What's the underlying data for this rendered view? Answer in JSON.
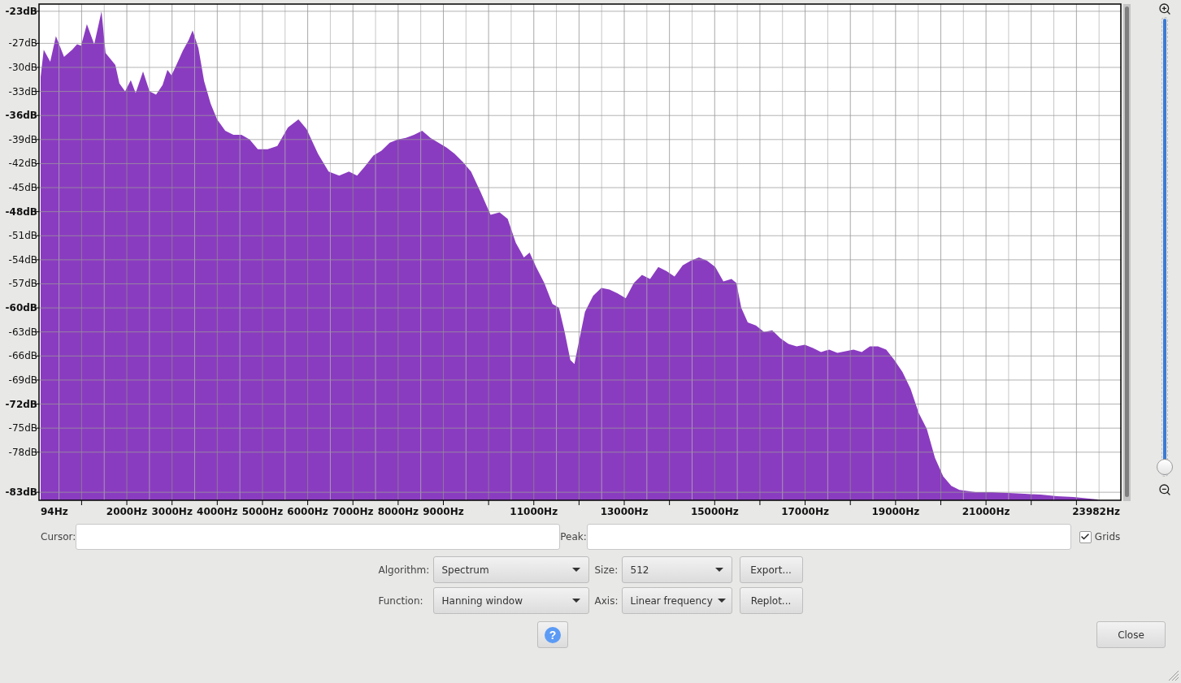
{
  "spectrum": {
    "chart_data": {
      "type": "area",
      "xlim": [
        94,
        23982
      ],
      "ylim": [
        -84,
        -22.1
      ],
      "x": [
        94,
        94,
        162,
        306,
        432,
        612,
        792,
        900,
        990,
        1116,
        1278,
        1440,
        1530,
        1746,
        1836,
        1962,
        2088,
        2196,
        2358,
        2502,
        2646,
        2790,
        2898,
        2988,
        3096,
        3240,
        3366,
        3456,
        3582,
        3708,
        3852,
        3996,
        4176,
        4356,
        4536,
        4716,
        4896,
        5112,
        5328,
        5562,
        5796,
        5976,
        6228,
        6462,
        6696,
        6912,
        7092,
        7272,
        7452,
        7632,
        7812,
        7992,
        8172,
        8352,
        8532,
        8712,
        8892,
        9072,
        9252,
        9432,
        9612,
        9828,
        10044,
        10242,
        10422,
        10602,
        10782,
        10908,
        11052,
        11232,
        11412,
        11556,
        11682,
        11808,
        11898,
        12006,
        12132,
        12312,
        12492,
        12672,
        12852,
        13032,
        13212,
        13392,
        13572,
        13752,
        13932,
        14112,
        14292,
        14472,
        14652,
        14832,
        15012,
        15192,
        15372,
        15480,
        15588,
        15732,
        15912,
        16092,
        16272,
        16452,
        16632,
        16812,
        16992,
        17172,
        17352,
        17532,
        17712,
        17892,
        18072,
        18252,
        18432,
        18612,
        18792,
        18972,
        19152,
        19332,
        19512,
        19692,
        19872,
        20052,
        20232,
        20412,
        20772,
        21132,
        21492,
        21852,
        22212,
        22572,
        22932,
        23292,
        23472
      ],
      "series": [
        {
          "color": "#8a3cc0",
          "values": [
            -83.9,
            -31.2,
            -27.8,
            -29.3,
            -26.1,
            -28.7,
            -27.8,
            -27.1,
            -27.3,
            -24.6,
            -27.1,
            -23.0,
            -28.2,
            -29.7,
            -32.0,
            -33.0,
            -31.6,
            -33.2,
            -30.5,
            -33.0,
            -33.4,
            -32.2,
            -30.3,
            -31.0,
            -29.7,
            -27.9,
            -26.6,
            -25.4,
            -27.6,
            -31.7,
            -34.5,
            -36.5,
            -37.9,
            -38.4,
            -38.4,
            -39.0,
            -40.2,
            -40.2,
            -39.8,
            -37.5,
            -36.5,
            -37.7,
            -40.8,
            -43.0,
            -43.5,
            -43.0,
            -43.5,
            -42.3,
            -41.0,
            -40.4,
            -39.4,
            -39.0,
            -38.8,
            -38.4,
            -37.9,
            -38.8,
            -39.4,
            -40.0,
            -40.8,
            -41.8,
            -43.0,
            -45.6,
            -48.4,
            -48.1,
            -48.9,
            -51.9,
            -53.7,
            -53.1,
            -54.9,
            -56.9,
            -59.5,
            -60.0,
            -63.0,
            -66.5,
            -67.0,
            -64.0,
            -60.5,
            -58.5,
            -57.5,
            -57.7,
            -58.2,
            -58.8,
            -56.9,
            -55.9,
            -56.4,
            -54.9,
            -55.4,
            -56.1,
            -54.7,
            -54.1,
            -53.7,
            -54.1,
            -54.9,
            -56.7,
            -56.4,
            -56.9,
            -60.0,
            -61.8,
            -62.2,
            -63.0,
            -62.8,
            -63.8,
            -64.5,
            -64.8,
            -64.6,
            -65.0,
            -65.5,
            -65.2,
            -65.6,
            -65.4,
            -65.2,
            -65.5,
            -64.8,
            -64.8,
            -65.2,
            -66.5,
            -68.0,
            -70.1,
            -73.1,
            -75.1,
            -78.7,
            -81.0,
            -82.2,
            -82.7,
            -83.0,
            -83.0,
            -83.1,
            -83.2,
            -83.3,
            -83.5,
            -83.6,
            -83.8,
            -83.9
          ]
        }
      ],
      "grid": true,
      "yticks": [
        {
          "value": -23,
          "label": "-23dB"
        },
        {
          "value": -27,
          "label": "-27dB"
        },
        {
          "value": -30,
          "label": "-30dB"
        },
        {
          "value": -33,
          "label": "-33dB"
        },
        {
          "value": -36,
          "label": "-36dB"
        },
        {
          "value": -39,
          "label": "-39dB"
        },
        {
          "value": -42,
          "label": "-42dB"
        },
        {
          "value": -45,
          "label": "-45dB"
        },
        {
          "value": -48,
          "label": "-48dB"
        },
        {
          "value": -51,
          "label": "-51dB"
        },
        {
          "value": -54,
          "label": "-54dB"
        },
        {
          "value": -57,
          "label": "-57dB"
        },
        {
          "value": -60,
          "label": "-60dB"
        },
        {
          "value": -63,
          "label": "-63dB"
        },
        {
          "value": -66,
          "label": "-66dB"
        },
        {
          "value": -69,
          "label": "-69dB"
        },
        {
          "value": -72,
          "label": "-72dB"
        },
        {
          "value": -75,
          "label": "-75dB"
        },
        {
          "value": -78,
          "label": "-78dB"
        },
        {
          "value": -83,
          "label": "-83dB"
        }
      ],
      "xticks": [
        {
          "value": 94,
          "label": "94Hz"
        },
        {
          "value": 2000,
          "label": "2000Hz"
        },
        {
          "value": 3000,
          "label": "3000Hz"
        },
        {
          "value": 4000,
          "label": "4000Hz"
        },
        {
          "value": 5000,
          "label": "5000Hz"
        },
        {
          "value": 6000,
          "label": "6000Hz"
        },
        {
          "value": 7000,
          "label": "7000Hz"
        },
        {
          "value": 8000,
          "label": "8000Hz"
        },
        {
          "value": 9000,
          "label": "9000Hz"
        },
        {
          "value": 11000,
          "label": "11000Hz"
        },
        {
          "value": 13000,
          "label": "13000Hz"
        },
        {
          "value": 15000,
          "label": "15000Hz"
        },
        {
          "value": 17000,
          "label": "17000Hz"
        },
        {
          "value": 19000,
          "label": "19000Hz"
        },
        {
          "value": 21000,
          "label": "21000Hz"
        },
        {
          "value": 23982,
          "label": "23982Hz"
        }
      ]
    }
  },
  "zoom_slider": {
    "level": 0
  },
  "cursor": {
    "label": "Cursor:"
  },
  "peak": {
    "label": "Peak:"
  },
  "grids": {
    "label": "Grids",
    "checked": true
  },
  "settings": [
    {
      "label": "Algorithm:",
      "value": "Spectrum",
      "label2": "Size:",
      "value2": "512",
      "button": "Export..."
    },
    {
      "label": "Function:",
      "value": "Hanning window",
      "label2": "Axis:",
      "value2": "Linear frequency",
      "button": "Replot..."
    }
  ],
  "help_button": {
    "label": "?"
  },
  "close_button": {
    "label": "Close"
  }
}
